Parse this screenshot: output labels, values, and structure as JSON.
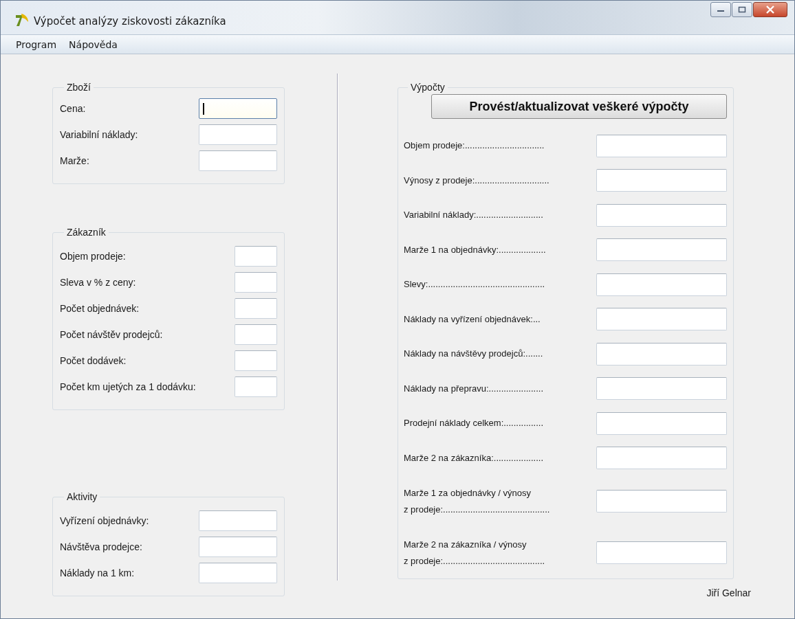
{
  "window": {
    "title": "Výpočet analýzy ziskovosti zákazníka"
  },
  "menu": [
    "Program",
    "Nápověda"
  ],
  "groups": [
    {
      "title": "Zboží",
      "fields": [
        {
          "label": "Cena:",
          "focused": true
        },
        {
          "label": "Variabilní náklady:",
          "focused": false
        },
        {
          "label": "Marže:",
          "focused": false
        }
      ]
    },
    {
      "title": "Zákazník",
      "fields": [
        {
          "label": "Objem prodeje:",
          "focused": false
        },
        {
          "label": "Sleva v % z ceny:",
          "focused": false
        },
        {
          "label": "Počet objednávek:",
          "focused": false
        },
        {
          "label": "Počet návštěv prodejců:",
          "focused": false
        },
        {
          "label": "Počet dodávek:",
          "focused": false
        },
        {
          "label": "Počet km ujetých za 1 dodávku:",
          "focused": false
        }
      ]
    },
    {
      "title": "Aktivity",
      "fields": [
        {
          "label": "Vyřízení objednávky:",
          "focused": false
        },
        {
          "label": "Návštěva prodejce:",
          "focused": false
        },
        {
          "label": "Náklady na 1 km:",
          "focused": false
        }
      ]
    }
  ],
  "calculations": {
    "title": "Výpočty",
    "button": "Provést/aktualizovat veškeré výpočty",
    "rows": [
      {
        "kind": "single",
        "label": "Objem prodeje:................................"
      },
      {
        "kind": "single",
        "label": "Výnosy z prodeje:.............................."
      },
      {
        "kind": "single",
        "label": "Variabilní náklady:..........................."
      },
      {
        "kind": "single",
        "label": "Marže 1 na objednávky:..................."
      },
      {
        "kind": "single",
        "label": "Slevy:..............................................."
      },
      {
        "kind": "single",
        "label": "Náklady na vyřízení objednávek:..."
      },
      {
        "kind": "single",
        "label": "Náklady na návštěvy prodejců:......."
      },
      {
        "kind": "single",
        "label": "Náklady na přepravu:......................"
      },
      {
        "kind": "single",
        "label": "Prodejní náklady celkem:................"
      },
      {
        "kind": "single",
        "label": "Marže 2 na zákazníka:...................."
      },
      {
        "kind": "wrapped",
        "label": "Marže 1 za objednávky / výnosy\nz prodeje:..........................................."
      },
      {
        "kind": "wrapped",
        "label": "Marže 2 na zákazníka / výnosy\n z prodeje:........................................."
      }
    ]
  },
  "author": "Jiří Gelnar"
}
